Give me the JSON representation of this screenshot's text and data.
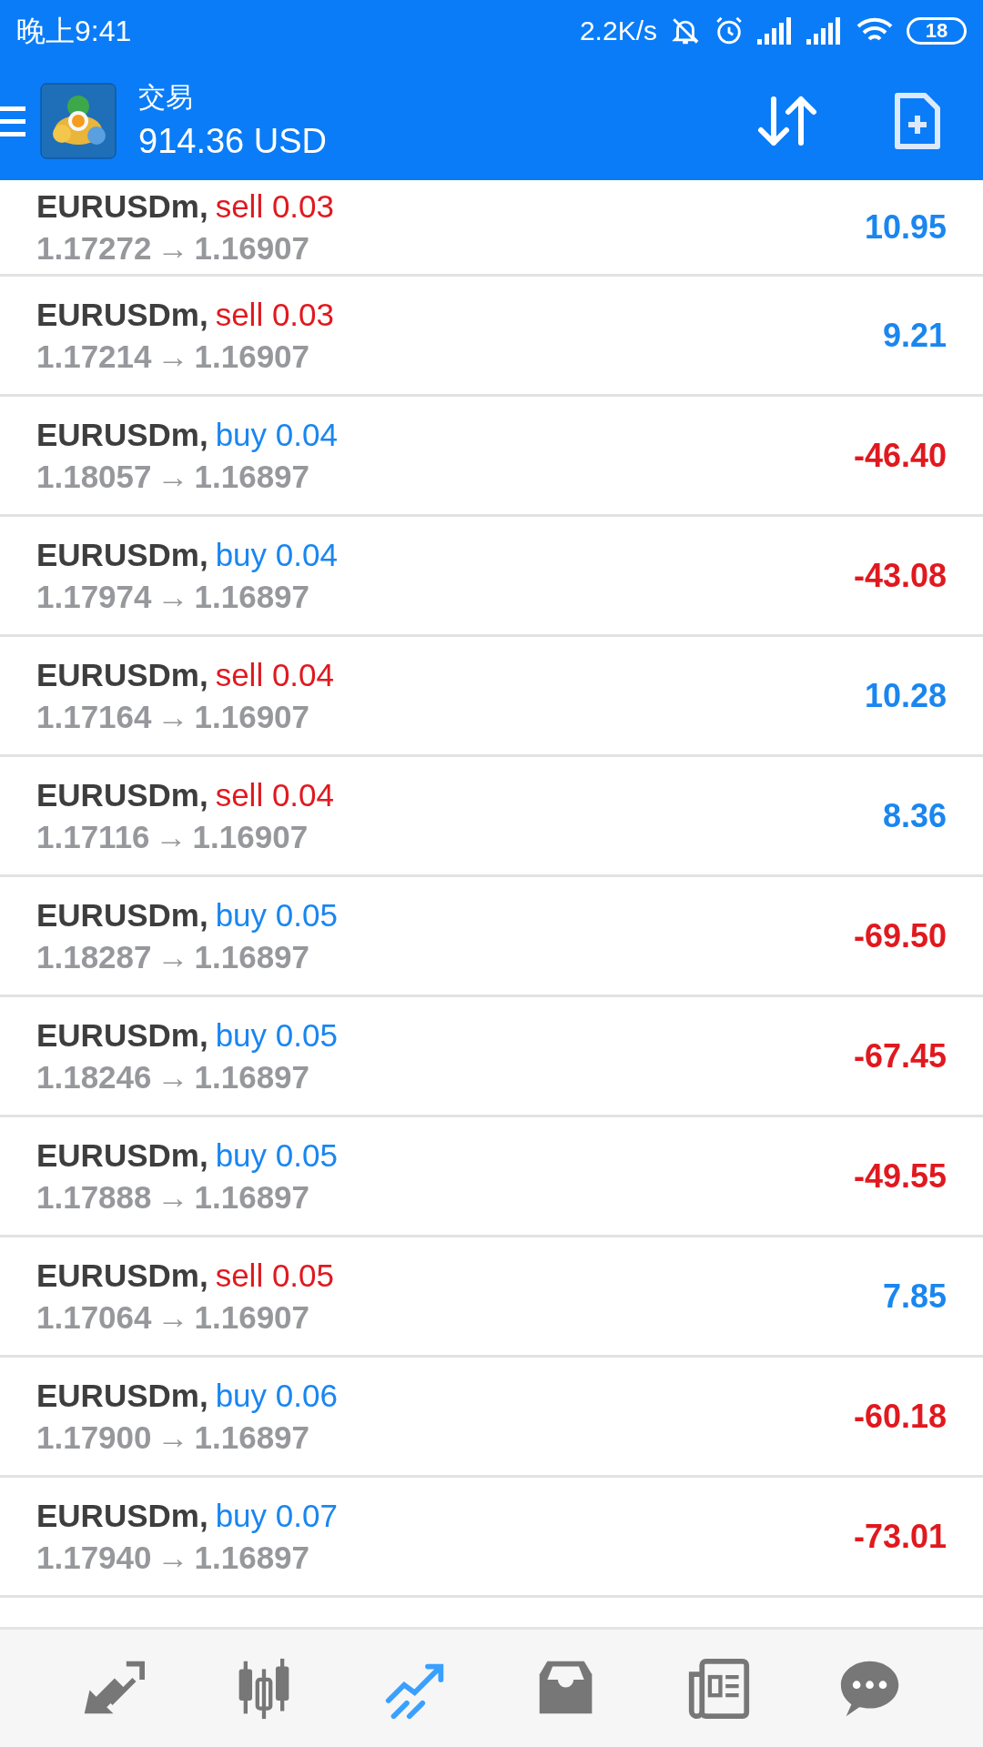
{
  "status_bar": {
    "time": "晚上9:41",
    "speed": "2.2K/s",
    "battery": "18"
  },
  "app_bar": {
    "title": "交易",
    "balance": "914.36 USD"
  },
  "positions": [
    {
      "symbol": "EURUSDm,",
      "order": "sell 0.03",
      "kind": "sell",
      "open_price": "1.17272",
      "arrow": "→",
      "close_price": "1.16907",
      "profit": "10.95",
      "loss": false
    },
    {
      "symbol": "EURUSDm,",
      "order": "sell 0.03",
      "kind": "sell",
      "open_price": "1.17214",
      "arrow": "→",
      "close_price": "1.16907",
      "profit": "9.21",
      "loss": false
    },
    {
      "symbol": "EURUSDm,",
      "order": "buy 0.04",
      "kind": "buy",
      "open_price": "1.18057",
      "arrow": "→",
      "close_price": "1.16897",
      "profit": "-46.40",
      "loss": true
    },
    {
      "symbol": "EURUSDm,",
      "order": "buy 0.04",
      "kind": "buy",
      "open_price": "1.17974",
      "arrow": "→",
      "close_price": "1.16897",
      "profit": "-43.08",
      "loss": true
    },
    {
      "symbol": "EURUSDm,",
      "order": "sell 0.04",
      "kind": "sell",
      "open_price": "1.17164",
      "arrow": "→",
      "close_price": "1.16907",
      "profit": "10.28",
      "loss": false
    },
    {
      "symbol": "EURUSDm,",
      "order": "sell 0.04",
      "kind": "sell",
      "open_price": "1.17116",
      "arrow": "→",
      "close_price": "1.16907",
      "profit": "8.36",
      "loss": false
    },
    {
      "symbol": "EURUSDm,",
      "order": "buy 0.05",
      "kind": "buy",
      "open_price": "1.18287",
      "arrow": "→",
      "close_price": "1.16897",
      "profit": "-69.50",
      "loss": true
    },
    {
      "symbol": "EURUSDm,",
      "order": "buy 0.05",
      "kind": "buy",
      "open_price": "1.18246",
      "arrow": "→",
      "close_price": "1.16897",
      "profit": "-67.45",
      "loss": true
    },
    {
      "symbol": "EURUSDm,",
      "order": "buy 0.05",
      "kind": "buy",
      "open_price": "1.17888",
      "arrow": "→",
      "close_price": "1.16897",
      "profit": "-49.55",
      "loss": true
    },
    {
      "symbol": "EURUSDm,",
      "order": "sell 0.05",
      "kind": "sell",
      "open_price": "1.17064",
      "arrow": "→",
      "close_price": "1.16907",
      "profit": "7.85",
      "loss": false
    },
    {
      "symbol": "EURUSDm,",
      "order": "buy 0.06",
      "kind": "buy",
      "open_price": "1.17900",
      "arrow": "→",
      "close_price": "1.16897",
      "profit": "-60.18",
      "loss": true
    },
    {
      "symbol": "EURUSDm,",
      "order": "buy 0.07",
      "kind": "buy",
      "open_price": "1.17940",
      "arrow": "→",
      "close_price": "1.16897",
      "profit": "-73.01",
      "loss": true
    }
  ],
  "bottom_nav": [
    {
      "selected": false
    },
    {
      "selected": false
    },
    {
      "selected": true
    },
    {
      "selected": false
    },
    {
      "selected": false
    },
    {
      "selected": false
    }
  ]
}
